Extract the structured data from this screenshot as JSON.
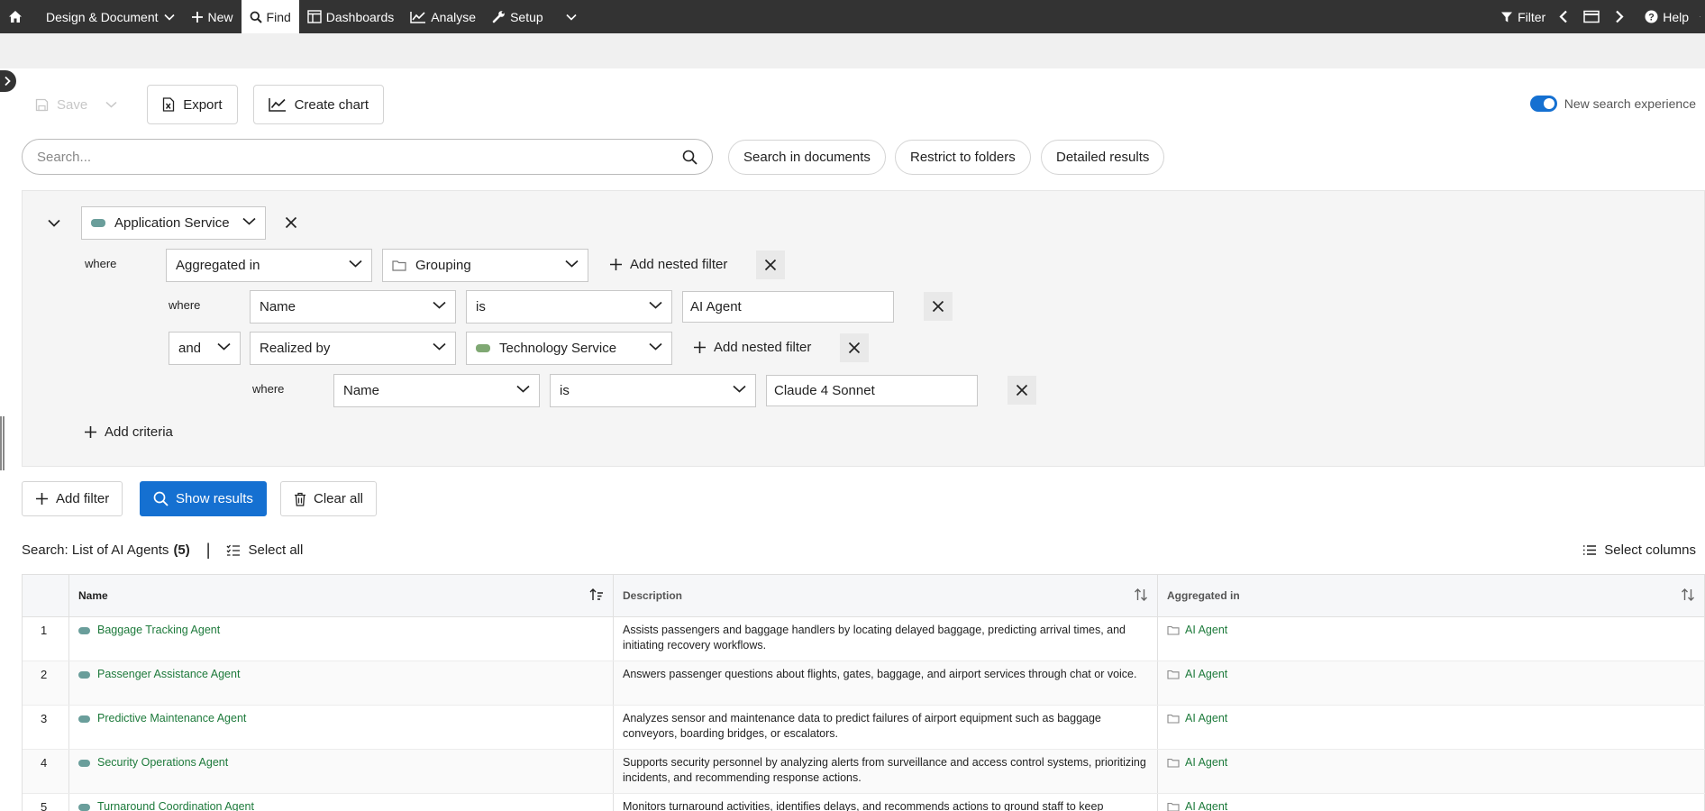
{
  "nav": {
    "home_icon": "home-icon",
    "design_document": "Design & Document",
    "new": "New",
    "find": "Find",
    "dashboards": "Dashboards",
    "analyse": "Analyse",
    "setup": "Setup",
    "filter": "Filter",
    "help": "Help"
  },
  "toolbar": {
    "save": "Save",
    "export": "Export",
    "create_chart": "Create chart",
    "new_search_experience": "New search experience"
  },
  "search": {
    "placeholder": "Search...",
    "value": "",
    "search_in_documents": "Search in documents",
    "restrict_to_folders": "Restrict to folders",
    "detailed_results": "Detailed results"
  },
  "filter": {
    "type": "Application Service",
    "type_color": "#6a9e9b",
    "where": "where",
    "and": "and",
    "row1": {
      "relation": "Aggregated in",
      "target": "Grouping",
      "add_nested": "Add nested filter"
    },
    "row2": {
      "attribute": "Name",
      "operator": "is",
      "value": "AI Agent"
    },
    "row3": {
      "connector": "and",
      "relation": "Realized by",
      "target": "Technology Service",
      "target_color": "#7fa873",
      "add_nested": "Add nested filter"
    },
    "row4": {
      "attribute": "Name",
      "operator": "is",
      "value": "Claude 4 Sonnet"
    },
    "add_criteria": "Add criteria"
  },
  "actions": {
    "add_filter": "Add filter",
    "show_results": "Show results",
    "clear_all": "Clear all"
  },
  "results": {
    "label": "Search: List of AI Agents",
    "count": "(5)",
    "sep": "|",
    "select_all": "Select all",
    "select_columns": "Select columns"
  },
  "table": {
    "columns": [
      "Name",
      "Description",
      "Aggregated in"
    ],
    "rows": [
      {
        "num": "1",
        "name": "Baggage Tracking Agent",
        "description": "Assists passengers and baggage handlers by locating delayed baggage, predicting arrival times, and initiating recovery workflows.",
        "aggregated_in": "AI Agent"
      },
      {
        "num": "2",
        "name": "Passenger Assistance Agent",
        "description": "Answers passenger questions about flights, gates, baggage, and airport services through chat or voice.",
        "aggregated_in": "AI Agent"
      },
      {
        "num": "3",
        "name": "Predictive Maintenance Agent",
        "description": "Analyzes sensor and maintenance data to predict failures of airport equipment such as baggage conveyors, boarding bridges, or escalators.",
        "aggregated_in": "AI Agent"
      },
      {
        "num": "4",
        "name": "Security Operations Agent",
        "description": "Supports security personnel by analyzing alerts from surveillance and access control systems, prioritizing incidents, and recommending response actions.",
        "aggregated_in": "AI Agent"
      },
      {
        "num": "5",
        "name": "Turnaround Coordination Agent",
        "description": "Monitors turnaround activities, identifies delays, and recommends actions to ground staff to keep",
        "aggregated_in": "AI Agent"
      }
    ]
  }
}
